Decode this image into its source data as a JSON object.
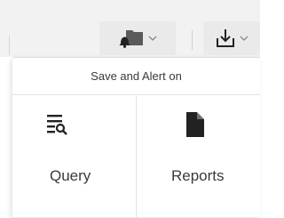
{
  "toolbar": {
    "notify_icon": "bell-folder-icon",
    "download_icon": "download-icon",
    "chevron_icon": "chevron-down-icon"
  },
  "popover": {
    "title": "Save and Alert on",
    "options": [
      {
        "label": "Query",
        "icon": "query-list-search-icon"
      },
      {
        "label": "Reports",
        "icon": "document-icon"
      }
    ]
  },
  "colors": {
    "toolbar_bg": "#f2f2f2",
    "icon_color": "#222222",
    "text_color": "#3a3a3a",
    "divider": "#e2e2e2"
  }
}
